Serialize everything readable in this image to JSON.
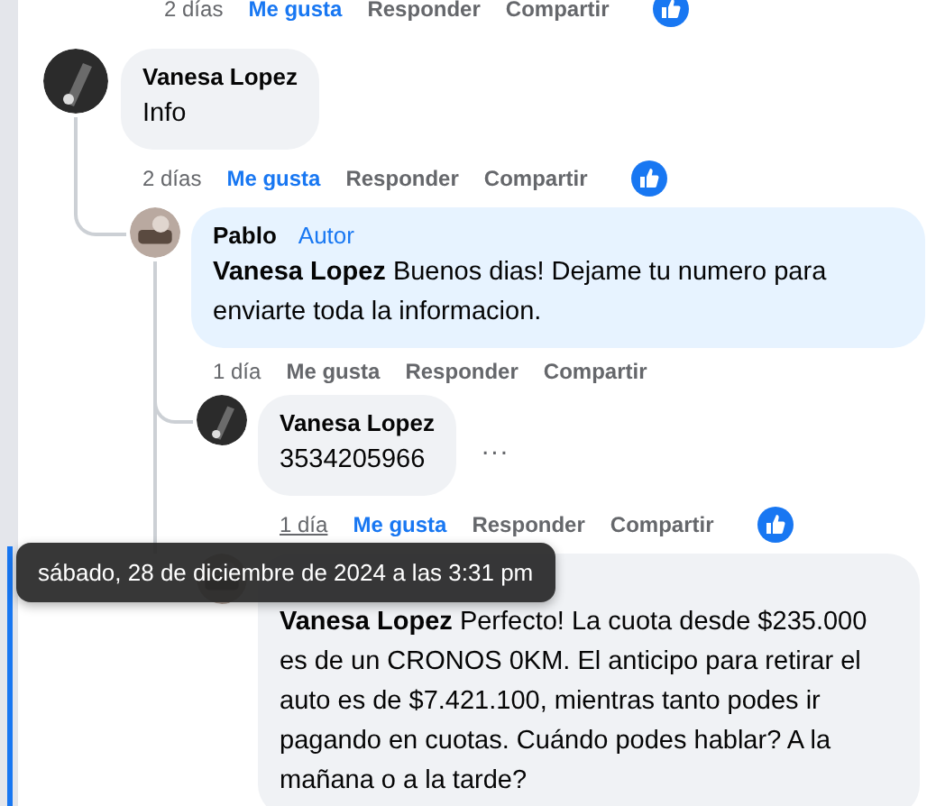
{
  "top_actions": {
    "time": "2 días",
    "like": "Me gusta",
    "liked": true,
    "reply": "Responder",
    "share": "Compartir",
    "reaction": true,
    "underlined": false
  },
  "comments": [
    {
      "author": "Vanesa Lopez",
      "text": "Info",
      "actions": {
        "time": "2 días",
        "like": "Me gusta",
        "liked": true,
        "reply": "Responder",
        "share": "Compartir",
        "reaction": true,
        "underlined": false
      },
      "children": [
        {
          "author": "Pablo",
          "badge": "Autor",
          "mention": "Vanesa Lopez",
          "text": "Buenos dias! Dejame tu numero para enviarte toda la informacion.",
          "actions": {
            "time": "1 día",
            "like": "Me gusta",
            "liked": false,
            "reply": "Responder",
            "share": "Compartir",
            "underlined": false
          },
          "children": [
            {
              "author": "Vanesa Lopez",
              "text": "3534205966",
              "more": "...",
              "actions": {
                "time": "1 día",
                "like": "Me gusta",
                "liked": true,
                "reply": "Responder",
                "share": "Compartir",
                "reaction": true,
                "underlined": true
              }
            },
            {
              "mention": "Vanesa Lopez",
              "text": "Perfecto! La cuota desde $235.000 es de un CRONOS 0KM. El anticipo para retirar el auto es de $7.421.100, mientras tanto podes ir pagando en cuotas. Cuándo podes hablar? A la mañana o a la tarde?",
              "highlighted": true,
              "tooltip": "sábado, 28 de diciembre de 2024 a las 3:31 pm"
            }
          ]
        }
      ]
    }
  ]
}
